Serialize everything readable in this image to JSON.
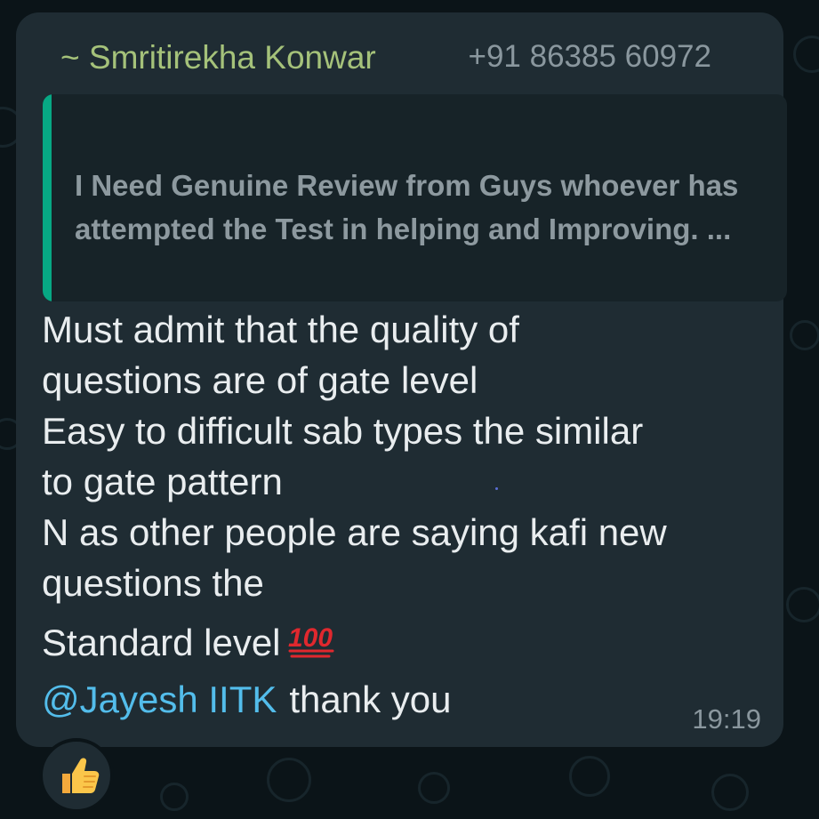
{
  "message": {
    "sender_name": "~ Smritirekha Konwar",
    "sender_phone": "+91 86385 60972",
    "quoted_text": "I Need Genuine Review from Guys whoever has attempted the Test in helping and Improving. ...",
    "lines": [
      "Must admit that the quality of",
      "questions are of gate level",
      "Easy to difficult sab types the similar",
      "to gate pattern",
      "N as other people are saying kafi new",
      "questions the"
    ],
    "standard_line": "Standard level",
    "standard_emoji": "hundred-points-icon",
    "mention": "@Jayesh IITK",
    "thanks": "thank you",
    "time": "19:19"
  },
  "reaction": {
    "emoji": "thumbs-up-icon"
  },
  "colors": {
    "background": "#0b1418",
    "bubble": "#1f2c33",
    "sender_name": "#a5c27a",
    "quote_bar": "#07a884",
    "mention": "#53bdeb",
    "text": "#e9edef",
    "meta": "#8a979e"
  }
}
